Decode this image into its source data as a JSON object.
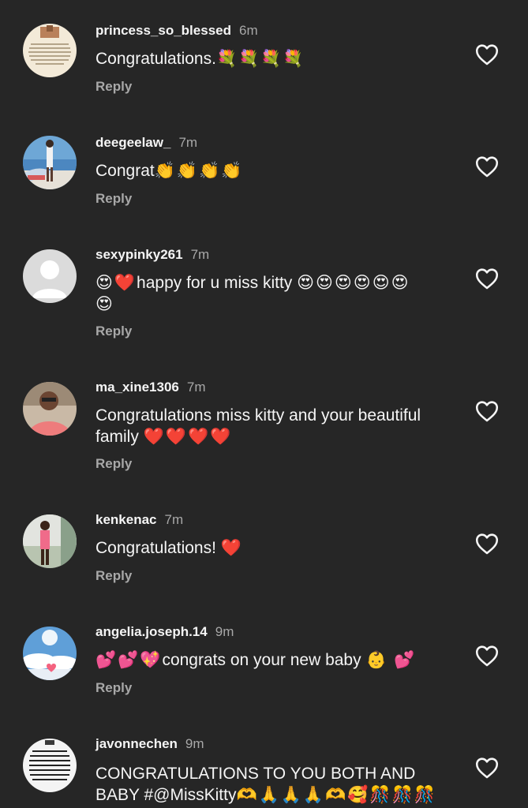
{
  "comments": [
    {
      "username": "princess_so_blessed",
      "time": "6m",
      "text": "Congratulations.",
      "emojis": "💐💐💐💐",
      "extra": "",
      "reply": "Reply",
      "avatar_icon": "scripture-quote-avatar"
    },
    {
      "username": "deegeelaw_",
      "time": "7m",
      "text": "Congrat",
      "emojis": "👏👏👏👏",
      "extra": "",
      "reply": "Reply",
      "avatar_icon": "beach-photo-avatar"
    },
    {
      "username": "sexypinky261",
      "time": "7m",
      "text": "happy for u miss kitty",
      "emojis_before": "😍❤️",
      "emojis": "😍😍😍😍😍😍",
      "extra": "😍",
      "reply": "Reply",
      "avatar_icon": "default-person-avatar"
    },
    {
      "username": "ma_xine1306",
      "time": "7m",
      "text": "Congratulations miss kitty and your beautiful family",
      "emojis": "❤️❤️❤️❤️",
      "extra": "",
      "reply": "Reply",
      "avatar_icon": "selfie-photo-avatar"
    },
    {
      "username": "kenkenac",
      "time": "7m",
      "text": "Congratulations!",
      "emojis": "❤️",
      "extra": "",
      "reply": "Reply",
      "avatar_icon": "standing-photo-avatar"
    },
    {
      "username": "angelia.joseph.14",
      "time": "9m",
      "text": "congrats on your new baby",
      "emojis_before": "💕💕💖",
      "emojis": "👶 💕",
      "extra": "",
      "reply": "Reply",
      "avatar_icon": "sky-photo-avatar"
    },
    {
      "username": "javonnechen",
      "time": "9m",
      "text": "CONGRATULATIONS TO YOU BOTH AND BABY #@MissKitty",
      "emojis": "🫶🙏🙏🙏🫶🥰🎊🎊🎊",
      "extra": "",
      "reply": "",
      "avatar_icon": "text-quote-avatar"
    }
  ],
  "colors": {
    "background": "#262626",
    "primary_text": "#f5f5f5",
    "secondary_text": "#a8a8a8"
  }
}
